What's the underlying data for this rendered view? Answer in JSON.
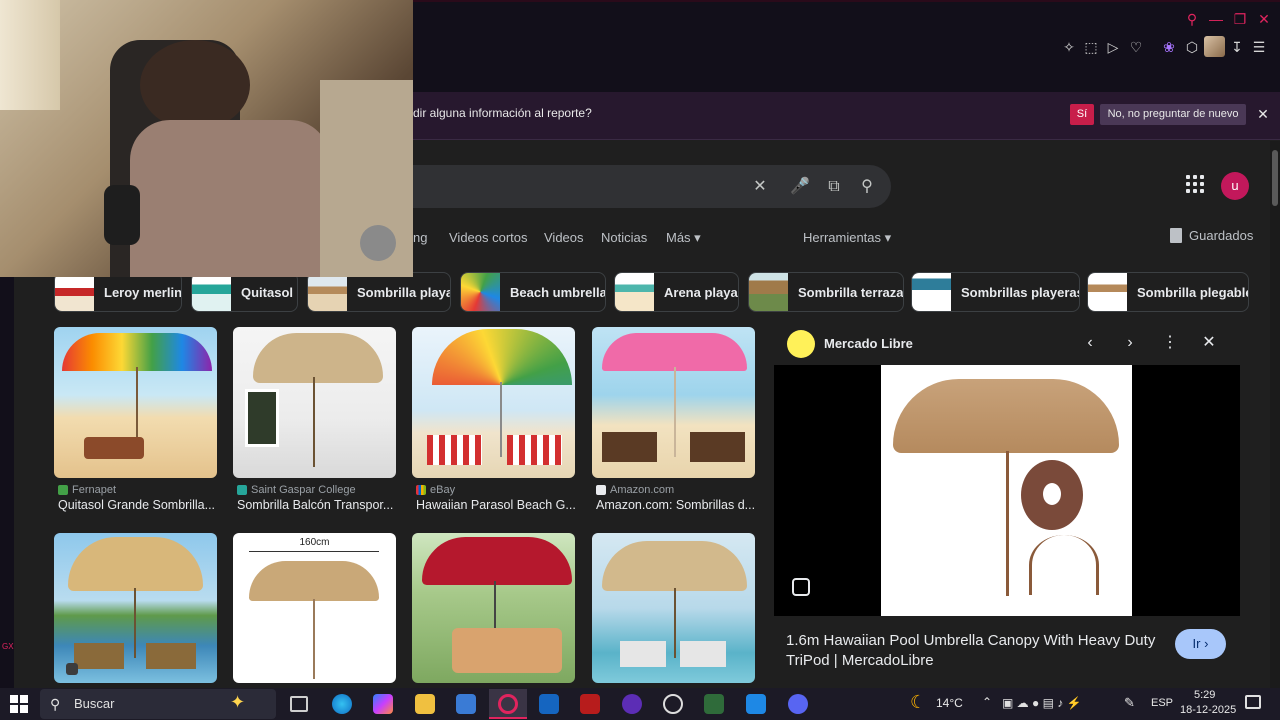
{
  "infobar": {
    "text": "dir alguna información al reporte?",
    "yes_label": "Sí",
    "no_label": "No, no preguntar de nuevo"
  },
  "nav": {
    "tabs": [
      "ng",
      "Videos cortos",
      "Videos",
      "Noticias",
      "Más ▾"
    ],
    "tools_label": "Herramientas ▾",
    "saved_label": "Guardados"
  },
  "avatar_letter": "u",
  "chips": [
    {
      "label": "Leroy merlin"
    },
    {
      "label": "Quitasol"
    },
    {
      "label": "Sombrilla playa"
    },
    {
      "label": "Beach umbrella"
    },
    {
      "label": "Arena playa"
    },
    {
      "label": "Sombrilla terraza"
    },
    {
      "label": "Sombrillas playeras"
    },
    {
      "label": "Sombrilla plegable"
    }
  ],
  "results": [
    {
      "source": "Fernapet",
      "title": "Quitasol Grande Sombrilla..."
    },
    {
      "source": "Saint Gaspar College",
      "title": "Sombrilla Balcón Transpor..."
    },
    {
      "source": "eBay",
      "title": "Hawaiian Parasol Beach G..."
    },
    {
      "source": "Amazon.com",
      "title": "Amazon.com: Sombrillas d..."
    }
  ],
  "image2_caption": "160cm",
  "panel": {
    "site": "Mercado Libre",
    "title": "1.6m Hawaiian Pool Umbrella Canopy With Heavy Duty TriPod | MercadoLibre",
    "go_label": "Ir ›"
  },
  "taskbar": {
    "search_label": "Buscar",
    "weather": "14°C",
    "lang": "ESP",
    "time": "5:29",
    "date": "18-12-2025"
  },
  "colors": {
    "accent": "#c81e4a",
    "avatar": "#c2185b",
    "go_button": "#a8c7fa"
  }
}
